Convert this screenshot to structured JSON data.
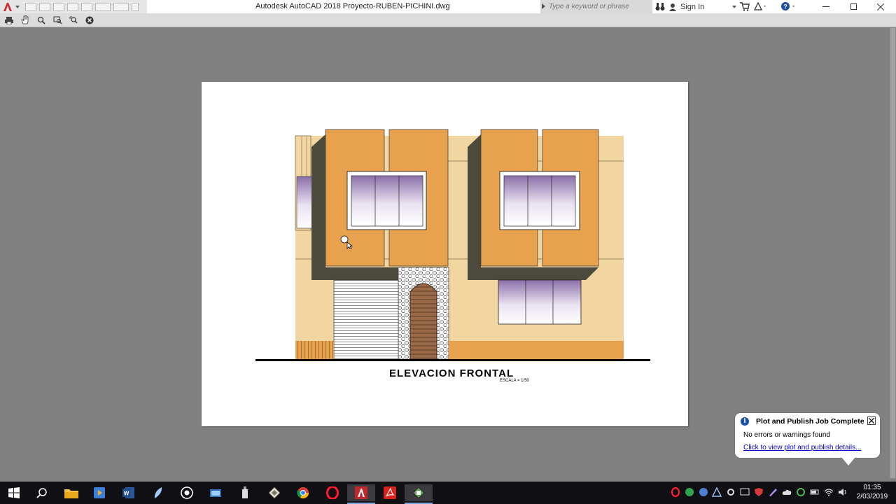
{
  "window": {
    "title": "Autodesk AutoCAD 2018   Proyecto-RUBEN-PICHINI.dwg",
    "search_placeholder": "Type a keyword or phrase",
    "sign_in": "Sign In"
  },
  "drawing": {
    "title": "ELEVACION FRONTAL",
    "scale": "ESCALA = 1/50",
    "colors": {
      "orange": "#e8a24e",
      "beige": "#f2d6a2",
      "dark": "#4b4a3c",
      "glass": "#c8b8d8"
    }
  },
  "notification": {
    "title": "Plot and Publish Job Complete",
    "message": "No errors or warnings found",
    "link": "Click to view plot and publish details..."
  },
  "taskbar": {
    "time": "01:35",
    "date": "2/03/2019",
    "apps": [
      "start-icon",
      "search-icon",
      "file-explorer-icon",
      "media-icon",
      "word-icon",
      "feather-icon",
      "capture-icon",
      "remote-icon",
      "usb-icon",
      "sketchup-icon",
      "chrome-icon",
      "opera-icon",
      "autocad-icon",
      "acrobat-icon",
      "autocad-plot-icon"
    ]
  }
}
